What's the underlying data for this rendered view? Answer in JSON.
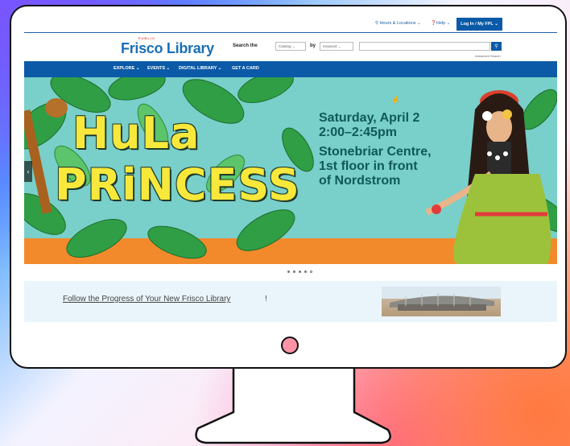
{
  "utility": {
    "hours_label": "Hours & Locations",
    "help_label": "Help",
    "login_label": "Log In / My FPL"
  },
  "header": {
    "logo_small": "PUBLIC",
    "logo": "Frisco Library",
    "search_the": "Search the",
    "catalog_option": "Catalog",
    "by_label": "by",
    "keyword_option": "Keyword",
    "search_placeholder": "",
    "advanced_search": "Advanced Search"
  },
  "nav": {
    "items": [
      {
        "label": "EXPLORE"
      },
      {
        "label": "EVENTS"
      },
      {
        "label": "DIGITAL LIBRARY"
      },
      {
        "label": "GET A CARD"
      }
    ]
  },
  "hero": {
    "title_line1": "HuLa",
    "title_line2": "PRiNCESS",
    "event_lines": [
      "Saturday, April 2",
      "2:00–2:45pm",
      "Stonebriar Centre,",
      "1st floor in front",
      "of Nordstrom"
    ]
  },
  "carousel": {
    "slide_count": 5,
    "active_index": 4
  },
  "promo": {
    "link_text": "Follow the Progress of Your New Frisco Library",
    "suffix": "!"
  },
  "colors": {
    "brand_blue": "#0b5aa7",
    "hero_teal": "#79cfc9",
    "hero_orange": "#f28a2c",
    "title_yellow": "#f7e83b"
  }
}
